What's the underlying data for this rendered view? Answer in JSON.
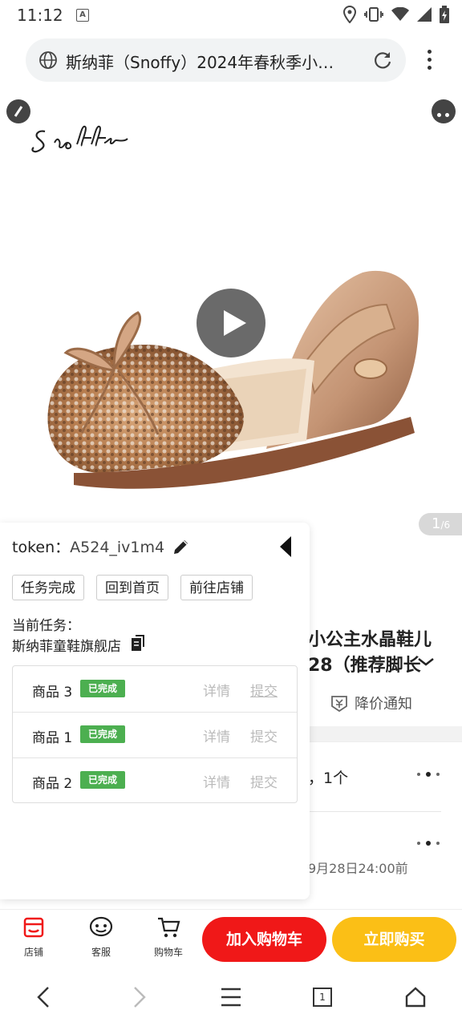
{
  "status_bar": {
    "time": "11:12",
    "notification_icon_letter": "A",
    "icons": [
      "location-icon",
      "vibrate-icon",
      "wifi-icon",
      "signal-icon",
      "battery-icon"
    ]
  },
  "browser": {
    "url_text": "斯纳菲（Snoffy）2024年春秋季小…",
    "icons": [
      "globe-icon",
      "reload-icon",
      "more-vert-icon"
    ]
  },
  "product": {
    "page_indicator_current": "1",
    "page_indicator_total": "/6",
    "title_line1": "小公主水晶鞋儿",
    "title_line2": "28（推荐脚长",
    "price_alert_label": "降价通知",
    "spec_text": "，1个",
    "delivery_text": "9月28日24:00前"
  },
  "task_panel": {
    "token_label": "token：",
    "token_value": "A524_iv1m4",
    "buttons": {
      "task_done": "任务完成",
      "back_home": "回到首页",
      "go_shop": "前往店铺"
    },
    "task_caption": "当前任务：",
    "task_shop": "斯纳菲童鞋旗舰店",
    "rows": [
      {
        "name": "商品 3",
        "status": "已完成",
        "detail": "详情",
        "submit": "提交"
      },
      {
        "name": "商品 1",
        "status": "已完成",
        "detail": "详情",
        "submit": "提交"
      },
      {
        "name": "商品 2",
        "status": "已完成",
        "detail": "详情",
        "submit": "提交"
      }
    ]
  },
  "action_bar": {
    "shop_label": "店铺",
    "service_label": "客服",
    "cart_label": "购物车",
    "add_to_cart": "加入购物车",
    "buy_now": "立即购买"
  },
  "nav_bar": {
    "tab_count": "1"
  },
  "colors": {
    "primary_red": "#f01818",
    "buy_yellow": "#fbbf16",
    "badge_green": "#4caf50"
  }
}
